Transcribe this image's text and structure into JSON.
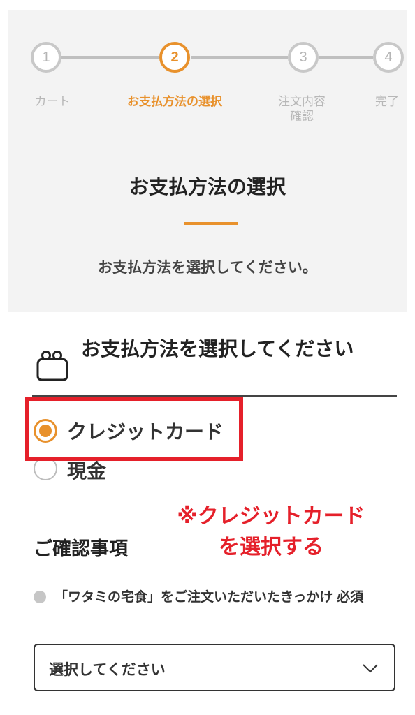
{
  "stepper": {
    "steps": [
      {
        "number": "1",
        "label": "カート",
        "active": false
      },
      {
        "number": "2",
        "label": "お支払方法の選択",
        "active": true
      },
      {
        "number": "3",
        "label": "注文内容\n確認",
        "active": false
      },
      {
        "number": "4",
        "label": "完了",
        "active": false
      }
    ]
  },
  "header": {
    "title": "お支払方法の選択",
    "subtitle": "お支払方法を選択してください。"
  },
  "payment": {
    "heading": "お支払方法を選択してください",
    "options": [
      {
        "label": "クレジットカード",
        "checked": true
      },
      {
        "label": "現金",
        "checked": false
      }
    ]
  },
  "annotation": {
    "line1": "※クレジットカード",
    "line2": "を選択する"
  },
  "confirm": {
    "heading": "ご確認事項",
    "question": "「ワタミの宅食」をご注文いただいたきっかけ",
    "required": "必須",
    "select_value": "選択してください"
  },
  "colors": {
    "accent": "#e8912c",
    "annotation_red": "#e5202a",
    "inactive": "#c8c8c8"
  },
  "icons": {
    "payment_heading": "wallet-icon",
    "select": "chevron-down-icon"
  }
}
